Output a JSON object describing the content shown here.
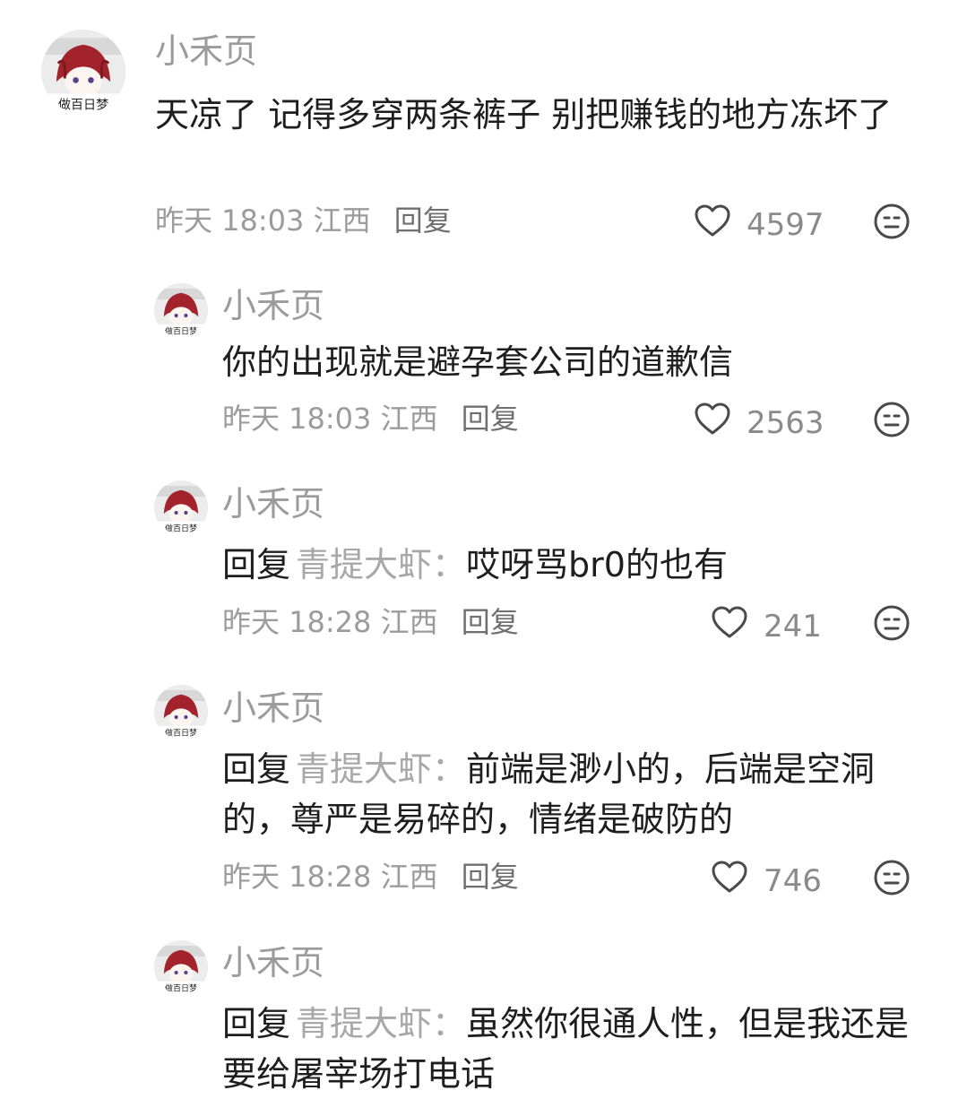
{
  "comments": [
    {
      "username": "小禾页",
      "reply_prefix": "",
      "reply_target": "",
      "text": "天凉了 记得多穿两条裤子 别把赚钱的地方冻坏了",
      "time": "昨天 18:03",
      "location": "江西",
      "reply_label": "回复",
      "likes": "4597"
    },
    {
      "username": "小禾页",
      "reply_prefix": "",
      "reply_target": "",
      "text": "你的出现就是避孕套公司的道歉信",
      "time": "昨天 18:03",
      "location": "江西",
      "reply_label": "回复",
      "likes": "2563"
    },
    {
      "username": "小禾页",
      "reply_prefix": "回复",
      "reply_target": "青提大虾：",
      "text": "哎呀骂br0的也有",
      "time": "昨天 18:28",
      "location": "江西",
      "reply_label": "回复",
      "likes": "241"
    },
    {
      "username": "小禾页",
      "reply_prefix": "回复",
      "reply_target": "青提大虾：",
      "text": "前端是渺小的，后端是空洞的，尊严是易碎的，情绪是破防的",
      "time": "昨天 18:28",
      "location": "江西",
      "reply_label": "回复",
      "likes": "746"
    },
    {
      "username": "小禾页",
      "reply_prefix": "回复",
      "reply_target": "青提大虾：",
      "text": "虽然你很通人性，但是我还是要给屠宰场打电话"
    }
  ],
  "avatar_caption": "做百日梦",
  "icons": {
    "like": "heart-outline-icon",
    "dislike": "meh-face-icon"
  },
  "colors": {
    "text": "#1e1e1e",
    "muted": "#9b9b9b",
    "reply_target": "#a8a8a8"
  }
}
